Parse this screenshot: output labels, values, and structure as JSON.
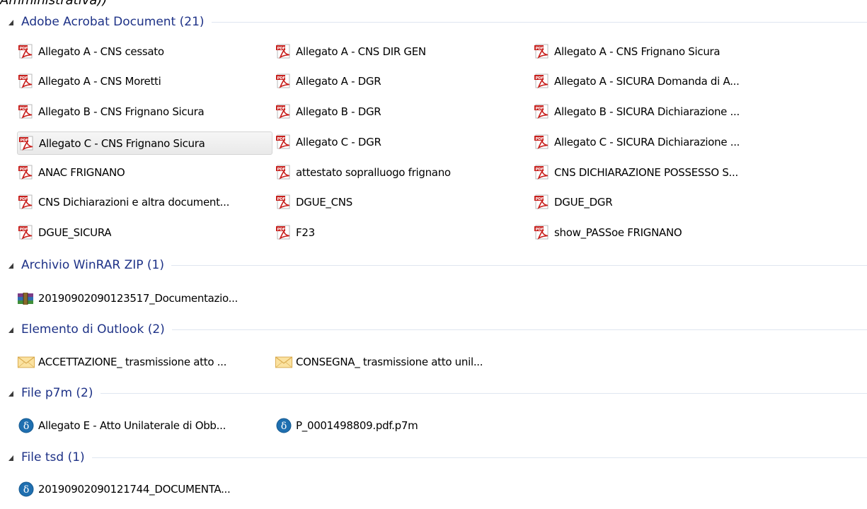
{
  "top_text": "Amministrativa))",
  "groups": [
    {
      "title": "Adobe Acrobat Document (21)",
      "items": [
        "Allegato A - CNS cessato",
        "Allegato A - CNS DIR GEN",
        "Allegato A - CNS Frignano Sicura",
        "Allegato A - CNS Moretti",
        "Allegato A - DGR",
        "Allegato A - SICURA Domanda di A...",
        "Allegato B - CNS Frignano Sicura",
        "Allegato B - DGR",
        "Allegato B - SICURA Dichiarazione ...",
        "Allegato C - CNS Frignano Sicura",
        "Allegato C - DGR",
        "Allegato C - SICURA Dichiarazione ...",
        "ANAC FRIGNANO",
        "attestato sopralluogo frignano",
        "CNS DICHIARAZIONE POSSESSO S...",
        "CNS Dichiarazioni e altra document...",
        "DGUE_CNS",
        "DGUE_DGR",
        "DGUE_SICURA",
        "F23",
        "show_PASSoe FRIGNANO"
      ]
    },
    {
      "title": "Archivio WinRAR ZIP (1)",
      "items": [
        "20190902090123517_Documentazio..."
      ]
    },
    {
      "title": "Elemento di Outlook (2)",
      "items": [
        "ACCETTAZIONE_ trasmissione atto ...",
        "CONSEGNA_ trasmissione atto unil..."
      ]
    },
    {
      "title": "File p7m (2)",
      "items": [
        "Allegato E - Atto Unilaterale di Obb...",
        "P_0001498809.pdf.p7m"
      ]
    },
    {
      "title": "File tsd (1)",
      "items": [
        "20190902090121744_DOCUMENTA..."
      ]
    }
  ],
  "icons": {
    "pdf": "pdf-icon",
    "zip": "winrar-zip-icon",
    "mail": "envelope-icon",
    "p7m": "delta-signature-icon",
    "collapse": "collapse-triangle-icon"
  },
  "colors": {
    "group_title": "#1e3287",
    "pdf_red": "#c8201d",
    "selection_bg": "#ececec"
  }
}
